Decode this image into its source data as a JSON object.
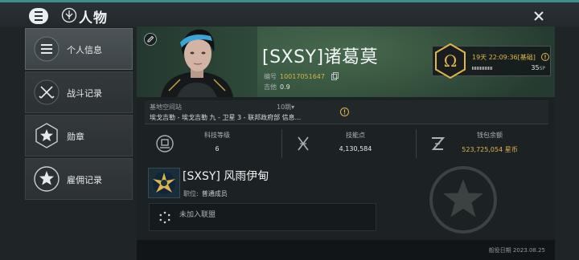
{
  "window": {
    "title": "人物",
    "menu_icon": "hamburger-menu-icon",
    "title_icon": "character-emblem-icon",
    "close_icon": "close-icon"
  },
  "sidebar": {
    "items": [
      {
        "label": "个人信息",
        "icon": "menu-lines-icon",
        "active": true
      },
      {
        "label": "战斗记录",
        "icon": "crossed-swords-icon",
        "active": false
      },
      {
        "label": "勋章",
        "icon": "star-medal-icon",
        "active": false
      },
      {
        "label": "雇佣记录",
        "icon": "star-badge-icon",
        "active": false
      }
    ]
  },
  "profile": {
    "name": "[SXSY]诸葛莫",
    "id_label": "编号",
    "id_value": "10017051647",
    "security_label": "吉他",
    "security_value": "0.9"
  },
  "omega": {
    "time": "19天 22:09:36[基础]",
    "sp_value": "35",
    "sp_unit": "SP",
    "icon": "omega-icon"
  },
  "station": {
    "label": "基地空间站",
    "jumps": "10跳▾",
    "location": "埃戈吉勒 - 埃戈吉勒 九 - 卫星 3 - 联邦政府部 信息..."
  },
  "stats": [
    {
      "label": "科技等级",
      "value": "6",
      "icon": "tech-level-icon",
      "gold": false
    },
    {
      "label": "技能点",
      "value": "4,130,584",
      "icon": "skill-points-icon",
      "gold": false
    },
    {
      "label": "钱包余额",
      "value": "523,725,054 星币",
      "icon": "isk-wallet-icon",
      "gold": true
    }
  ],
  "corporation": {
    "name": "[SXSY] 风雨伊甸",
    "position_label": "职位:",
    "position_value": "普通成员"
  },
  "alliance": {
    "text": "未加入联盟"
  },
  "footer": {
    "date": "般役日期 2023.08.25"
  },
  "colors": {
    "accent_gold": "#e0b64a",
    "accent_teal": "#3e8f8a"
  }
}
